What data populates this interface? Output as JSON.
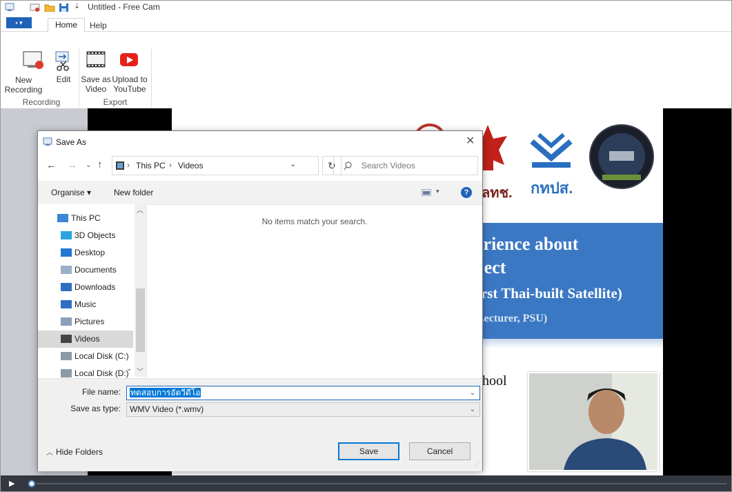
{
  "window": {
    "title": "Untitled - Free Cam"
  },
  "ribbon": {
    "file_label": "▪ ▾",
    "tabs": [
      {
        "label": "Home"
      },
      {
        "label": "Help"
      }
    ],
    "buttons": {
      "new_recording": "New\nRecording",
      "edit": "Edit",
      "save_as_video": "Save as\nVideo",
      "upload_youtube": "Upload to\nYouTube"
    },
    "groups": {
      "recording": "Recording",
      "export": "Export"
    }
  },
  "slide": {
    "line1": "erience about",
    "line2": "ject",
    "line3": "irst Thai-built Satellite)",
    "line4": "Lecturer, PSU)",
    "line5": "hool",
    "logo_text1": "ลทช.",
    "logo_text2": "กทปส."
  },
  "dialog": {
    "title": "Save As",
    "address": {
      "path1": "This PC",
      "path2": "Videos"
    },
    "search_placeholder": "Search Videos",
    "toolbar": {
      "organise": "Organise ▾",
      "new_folder": "New folder"
    },
    "tree": [
      {
        "label": "This PC",
        "indent": 1
      },
      {
        "label": "3D Objects",
        "indent": 2
      },
      {
        "label": "Desktop",
        "indent": 2
      },
      {
        "label": "Documents",
        "indent": 2
      },
      {
        "label": "Downloads",
        "indent": 2
      },
      {
        "label": "Music",
        "indent": 2
      },
      {
        "label": "Pictures",
        "indent": 2
      },
      {
        "label": "Videos",
        "indent": 2
      },
      {
        "label": "Local Disk (C:)",
        "indent": 2
      },
      {
        "label": "Local Disk (D:)",
        "indent": 2
      }
    ],
    "empty_message": "No items match your search.",
    "file_name_label": "File name:",
    "file_name_value": "ทดสอบการอัดวีดีโอ",
    "save_type_label": "Save as type:",
    "save_type_value": "WMV Video (*.wmv)",
    "hide_folders": "Hide Folders",
    "save_button": "Save",
    "cancel_button": "Cancel"
  },
  "colors": {
    "accent": "#1f63b8",
    "selection": "#cce8ff",
    "slide_blue": "#3b78c4",
    "youtube": "#e62117"
  }
}
